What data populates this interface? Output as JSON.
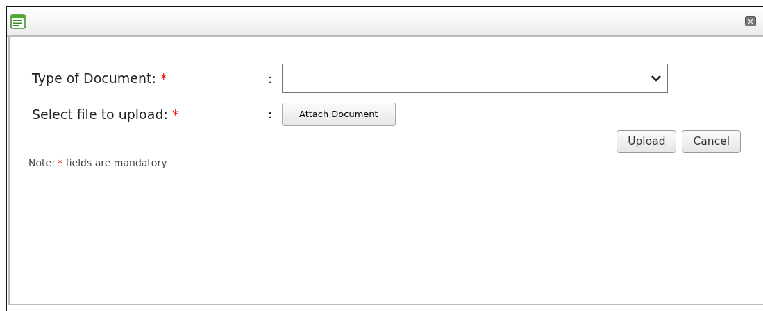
{
  "window": {
    "close_label": "×"
  },
  "fields": [
    {
      "kind": "select",
      "label": "Type of Document:",
      "required_mark": "*",
      "separator": ":"
    },
    {
      "kind": "file",
      "label": "Select file to upload:",
      "required_mark": "*",
      "separator": ":",
      "button": "Attach Document"
    }
  ],
  "buttons": [
    "Upload",
    "Cancel"
  ],
  "note": {
    "prefix": "Note:",
    "mark": "*",
    "text": "fields are mandatory"
  }
}
